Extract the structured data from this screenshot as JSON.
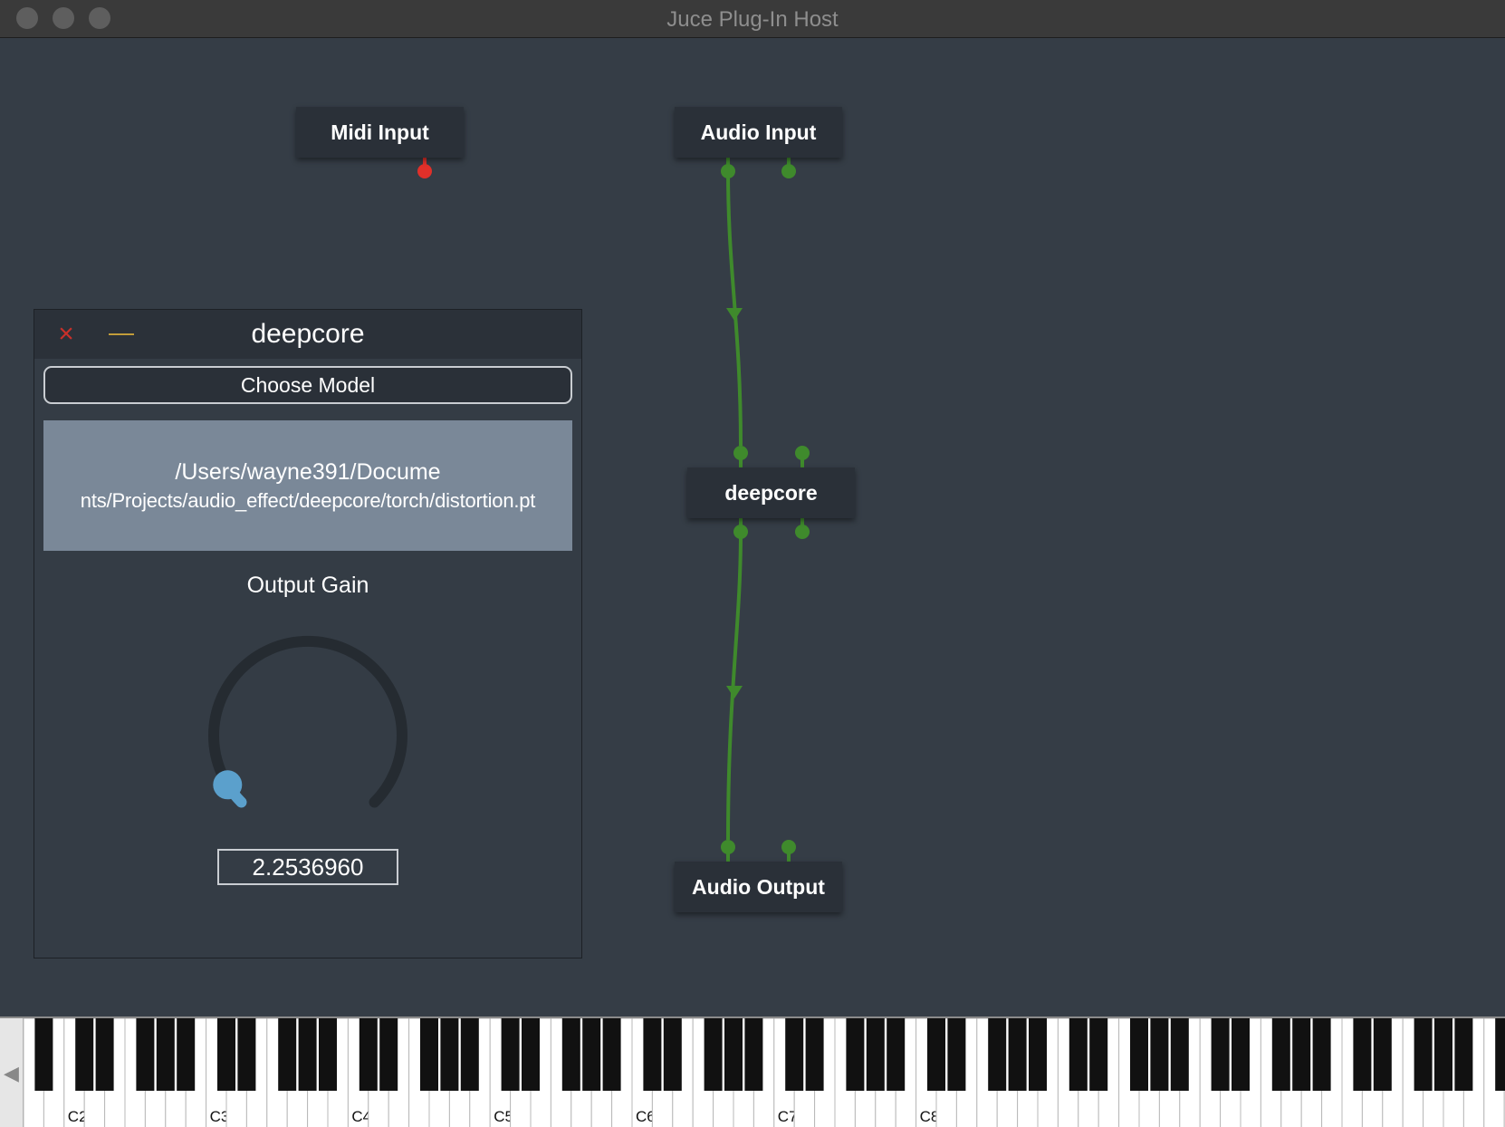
{
  "window": {
    "title": "Juce Plug-In Host"
  },
  "graph": {
    "nodes": {
      "midi_input": "Midi Input",
      "audio_input": "Audio Input",
      "deepcore": "deepcore",
      "audio_output": "Audio Output"
    },
    "colors": {
      "audio_wire": "#3f8a2c",
      "midi_pin": "#e0302a"
    }
  },
  "plugin_window": {
    "title": "deepcore",
    "close_icon": "×",
    "minimise_icon": "—",
    "choose_model_label": "Choose Model",
    "model_path_line1": "/Users/wayne391/Docume",
    "model_path_line2": "nts/Projects/audio_effect/deepcore/torch/distortion.pt",
    "gain_label": "Output Gain",
    "gain_value": "2.2536960",
    "gain_fraction": 0.05,
    "knob_color": "#5ba0cc"
  },
  "keyboard": {
    "scroll_left_icon": "◀",
    "octave_labels": [
      "C2",
      "C3",
      "C4",
      "C5",
      "C6",
      "C7",
      "C8"
    ]
  }
}
